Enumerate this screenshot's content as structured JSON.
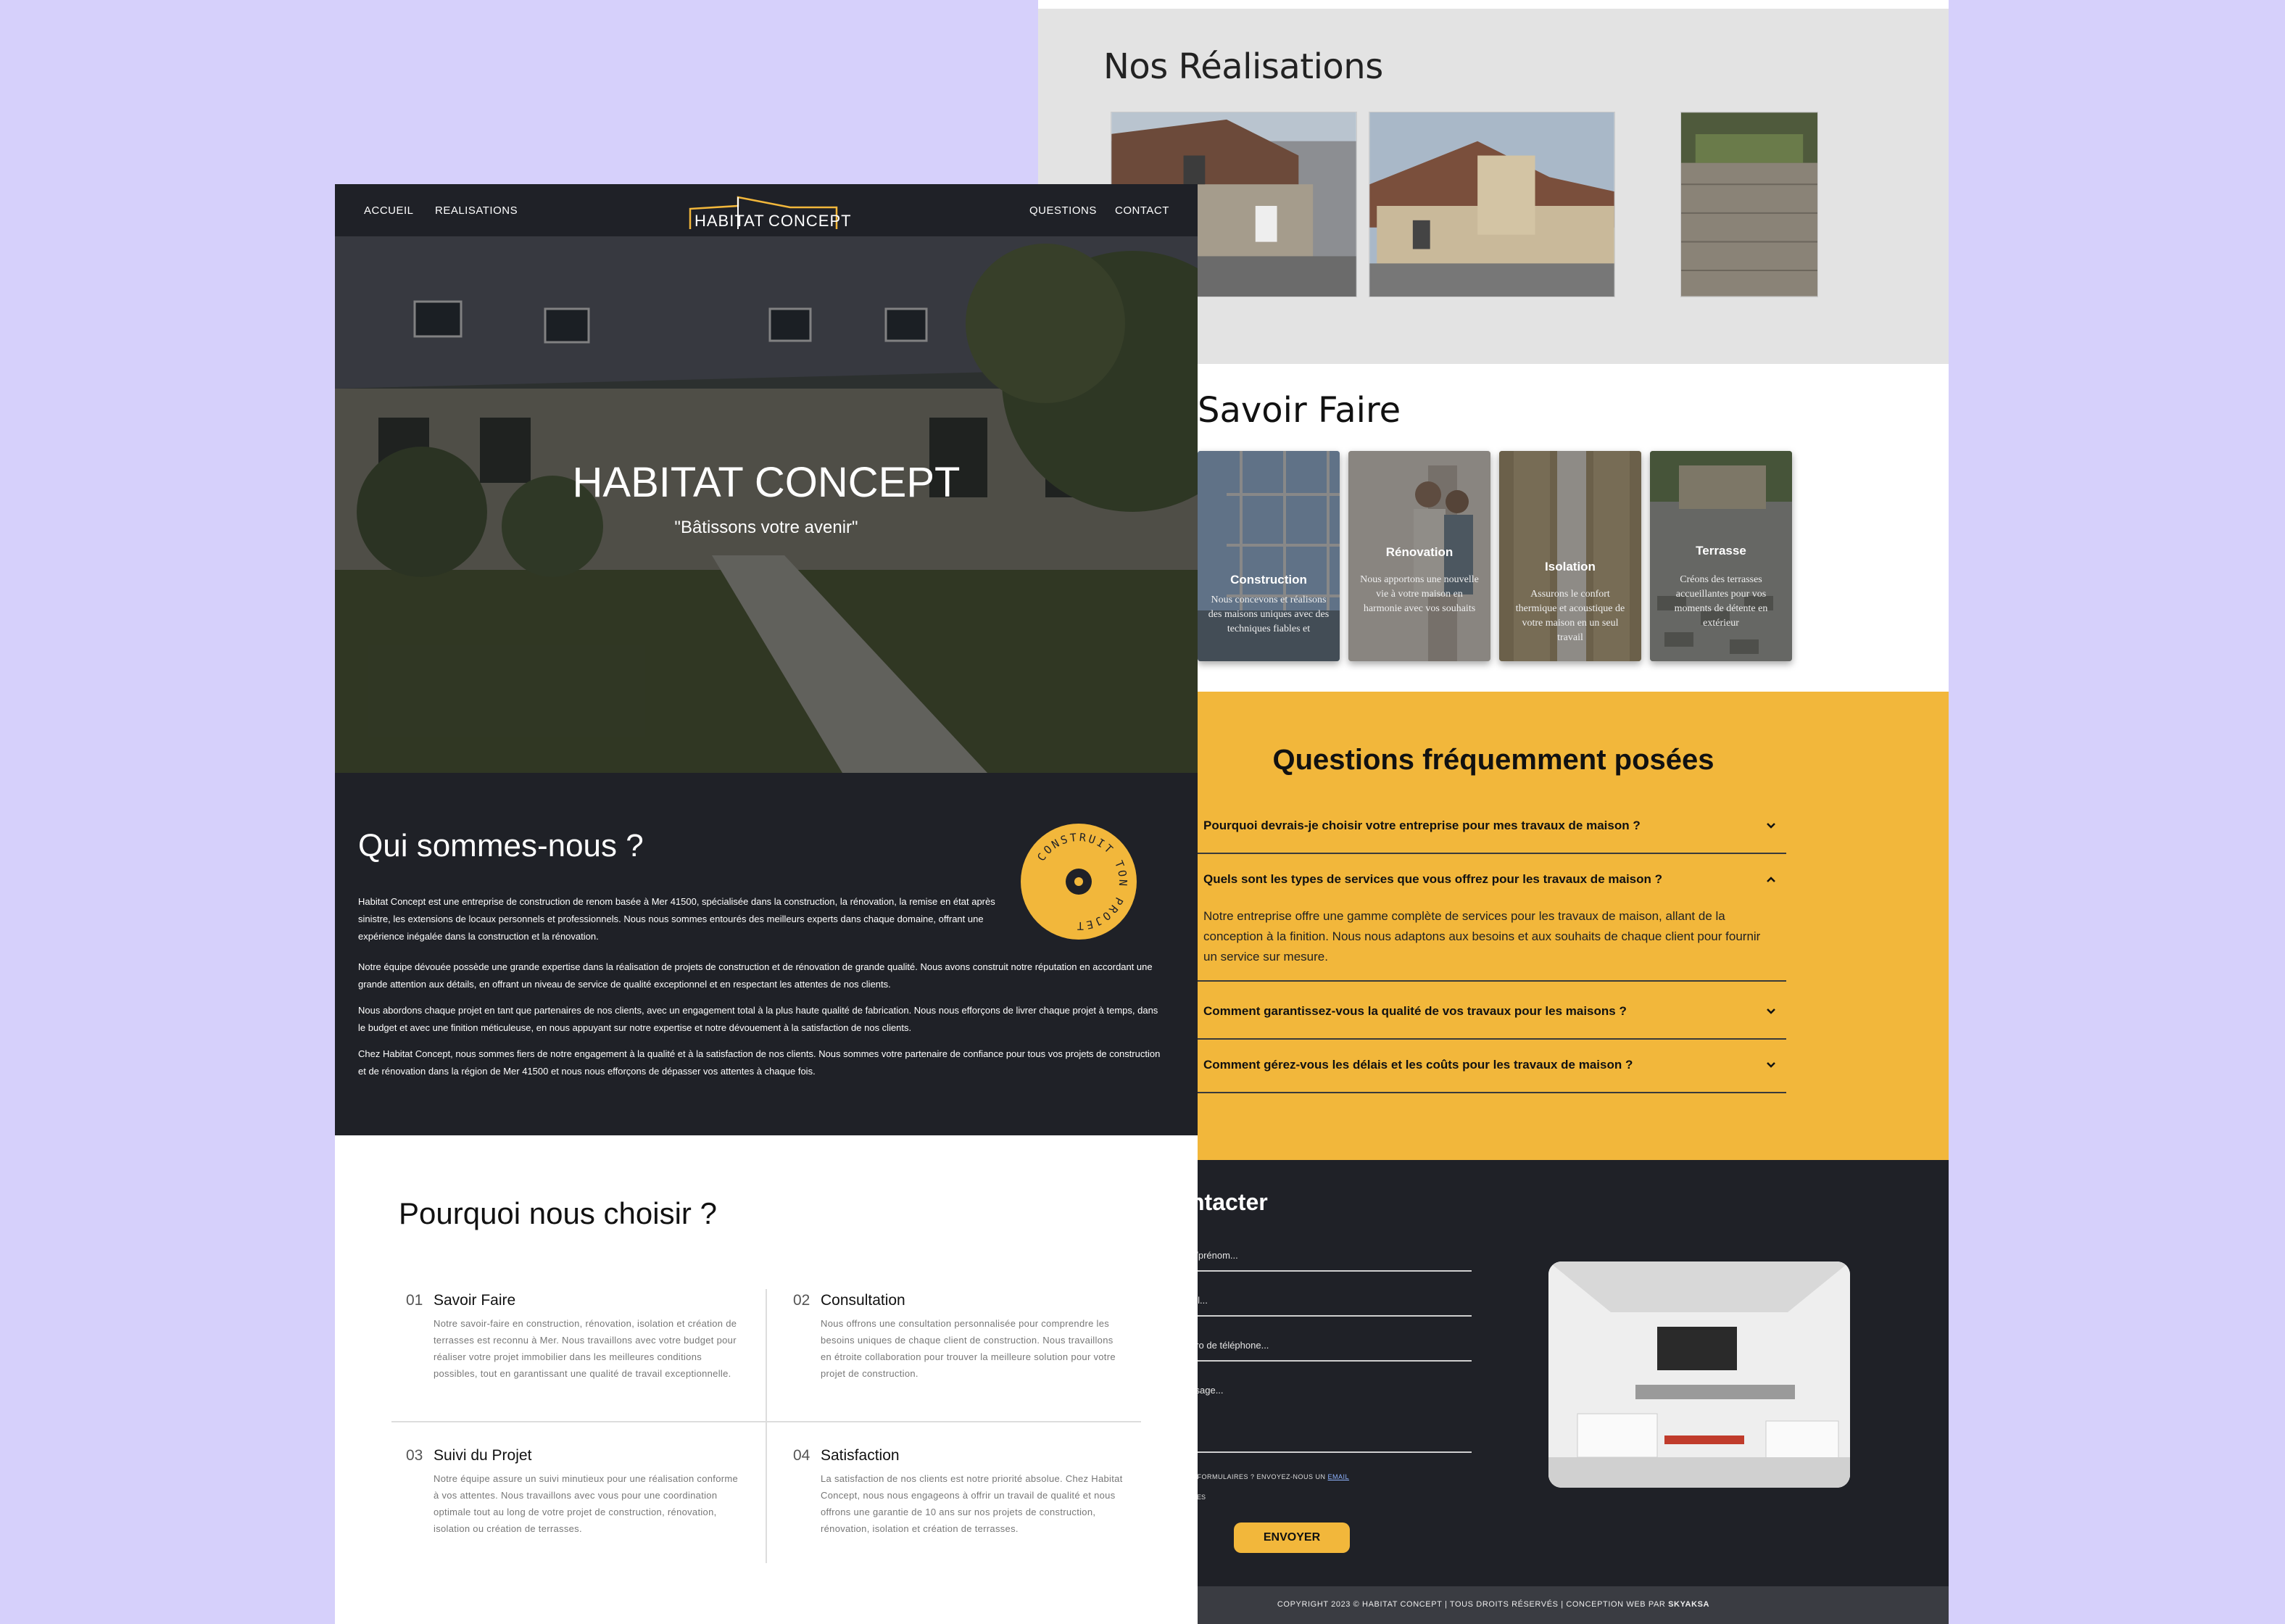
{
  "colors": {
    "accent": "#f2b73b",
    "dark": "#1f2127",
    "background": "#d6d0fb"
  },
  "back": {
    "realisations": {
      "title": "Nos Réalisations"
    },
    "savoir": {
      "title": "Savoir Faire",
      "cards": [
        {
          "title": "Construction",
          "text": "Nous concevons et réalisons des maisons uniques avec des techniques fiables et"
        },
        {
          "title": "Rénovation",
          "text": "Nous apportons une nouvelle vie à votre maison en harmonie avec vos souhaits"
        },
        {
          "title": "Isolation",
          "text": "Assurons le confort thermique et acoustique de votre maison en un seul travail"
        },
        {
          "title": "Terrasse",
          "text": "Créons des terrasses accueillantes pour vos moments de détente en extérieur"
        }
      ]
    },
    "faq": {
      "title": "Questions fréquemment posées",
      "items": [
        {
          "q": "Pourquoi devrais-je choisir votre entreprise pour mes travaux de maison ?"
        },
        {
          "q": "Quels sont les types de services que vous offrez pour les travaux de maison ?",
          "a": "Notre entreprise offre une gamme complète de services pour les travaux de maison, allant de la conception à la finition. Nous nous adaptons aux besoins et aux souhaits de chaque client pour fournir un service sur mesure."
        },
        {
          "q": "Comment garantissez-vous la qualité de vos travaux pour les maisons ?"
        },
        {
          "q": "Comment gérez-vous les délais et les coûts pour les travaux de maison ?"
        }
      ]
    },
    "contact": {
      "title": "ntacter",
      "fields": [
        "n/prénom...",
        "ail...",
        "éro de téléphone...",
        "ssage..."
      ],
      "note": "S FORMULAIRES ? ENVOYEZ-NOUS UN",
      "note_link": "EMAIL",
      "note2": "IRES",
      "send": "ENVOYER"
    },
    "footer": {
      "text": "COPYRIGHT 2023 © HABITAT CONCEPT | TOUS DROITS RÉSERVÉS | CONCEPTION WEB PAR",
      "brand": "SKYAKSA"
    }
  },
  "front": {
    "nav": {
      "left": [
        "ACCUEIL",
        "REALISATIONS"
      ],
      "right": [
        "QUESTIONS",
        "CONTACT"
      ],
      "logo_a": "HABITAT",
      "logo_b": "CONCEPT"
    },
    "hero": {
      "title": "HABITAT CONCEPT",
      "subtitle": "\"Bâtissons votre avenir\""
    },
    "about": {
      "title": "Qui sommes-nous ?",
      "stamp_text": "CONSTRUIT TON PROJET",
      "paragraphs": [
        "Habitat Concept est une entreprise de construction de renom basée à Mer 41500, spécialisée dans la construction, la rénovation, la remise en état après sinistre, les extensions de locaux personnels et professionnels. Nous nous sommes entourés des meilleurs experts dans chaque domaine, offrant une expérience inégalée dans la construction et la rénovation.",
        "Notre équipe dévouée possède une grande expertise dans la réalisation de projets de construction et de rénovation de grande qualité. Nous avons construit notre réputation en accordant une grande attention aux détails, en offrant un niveau de service de qualité exceptionnel et en respectant les attentes de nos clients.",
        "Nous abordons chaque projet en tant que partenaires de nos clients, avec un engagement total à la plus haute qualité de fabrication. Nous nous efforçons de livrer chaque projet à temps, dans le budget et avec une finition méticuleuse, en nous appuyant sur notre expertise et notre dévouement à la satisfaction de nos clients.",
        "Chez Habitat Concept, nous sommes fiers de notre engagement à la qualité et à la satisfaction de nos clients. Nous sommes votre partenaire de confiance pour tous vos projets de construction et de rénovation dans la région de Mer 41500 et nous nous efforçons de dépasser vos attentes à chaque fois."
      ]
    },
    "why": {
      "title": "Pourquoi nous choisir ?",
      "items": [
        {
          "num": "01",
          "title": "Savoir Faire",
          "text": "Notre savoir-faire en construction, rénovation, isolation et création de terrasses est reconnu à Mer. Nous travaillons avec votre budget pour réaliser votre projet immobilier dans les meilleures conditions possibles, tout en garantissant une qualité de travail exceptionnelle."
        },
        {
          "num": "02",
          "title": "Consultation",
          "text": "Nous offrons une consultation personnalisée pour comprendre les besoins uniques de chaque client de construction. Nous travaillons en étroite collaboration pour trouver la meilleure solution pour votre projet de construction."
        },
        {
          "num": "03",
          "title": "Suivi du Projet",
          "text": "Notre équipe assure un suivi minutieux pour une réalisation conforme à vos attentes. Nous travaillons avec vous pour une coordination optimale tout au long de votre projet de construction, rénovation, isolation ou création de terrasses."
        },
        {
          "num": "04",
          "title": "Satisfaction",
          "text": "La satisfaction de nos clients est notre priorité absolue. Chez Habitat Concept, nous nous engageons à offrir un travail de qualité et nous offrons une garantie de 10 ans sur nos projets de construction, rénovation, isolation et création de terrasses."
        }
      ]
    }
  }
}
